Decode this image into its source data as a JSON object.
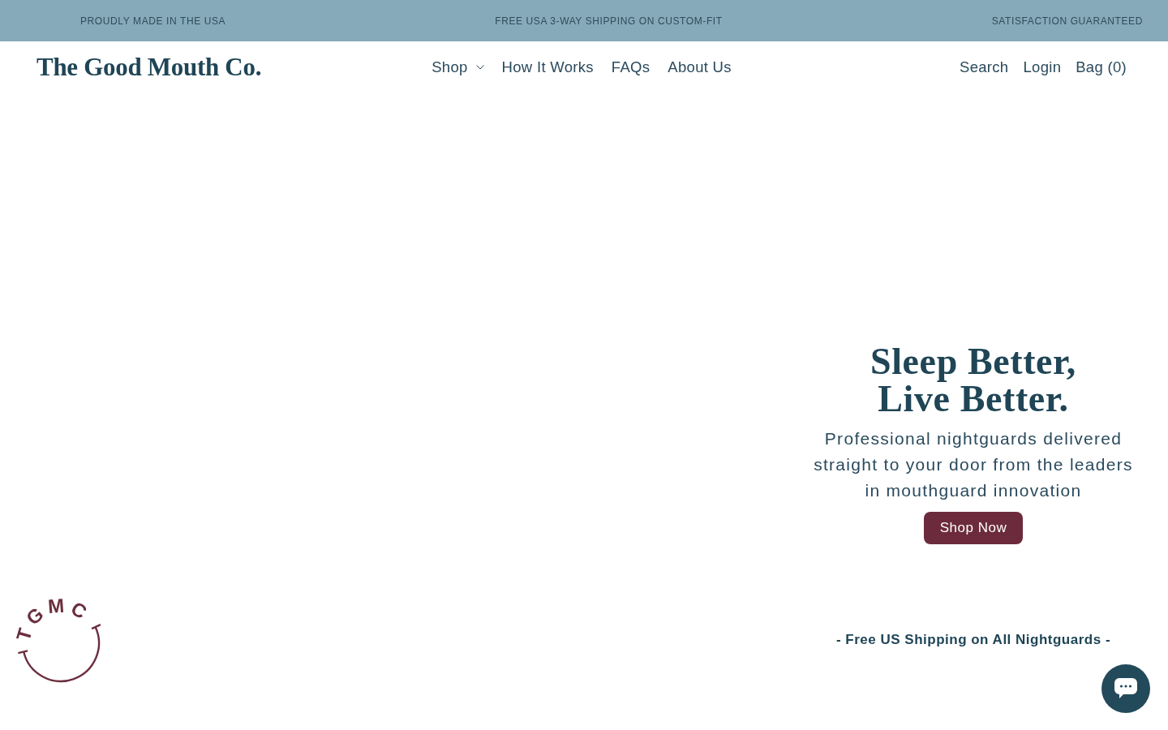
{
  "announcement_bar": {
    "items": [
      "PROUDLY MADE IN THE USA",
      "FREE USA 3-WAY SHIPPING ON CUSTOM-FIT",
      "SATISFACTION GUARANTEED"
    ]
  },
  "header": {
    "logo": "The Good Mouth Co.",
    "nav": [
      {
        "label": "Shop",
        "kind": "dropdown"
      },
      {
        "label": "How It Works",
        "kind": "link"
      },
      {
        "label": "FAQs",
        "kind": "link"
      },
      {
        "label": "About Us",
        "kind": "link"
      }
    ],
    "actions": [
      "Search",
      "Login",
      "Bag (0)"
    ]
  },
  "hero": {
    "heading_lines": [
      "Sleep Better,",
      "Live Better."
    ],
    "text": "Professional nightguards delivered straight to your door from the leaders in mouthguard innovation",
    "button": "Shop Now",
    "shipping_note": "- Free US Shipping on All Nightguards -"
  },
  "badge": {
    "letters": "TGMC"
  }
}
